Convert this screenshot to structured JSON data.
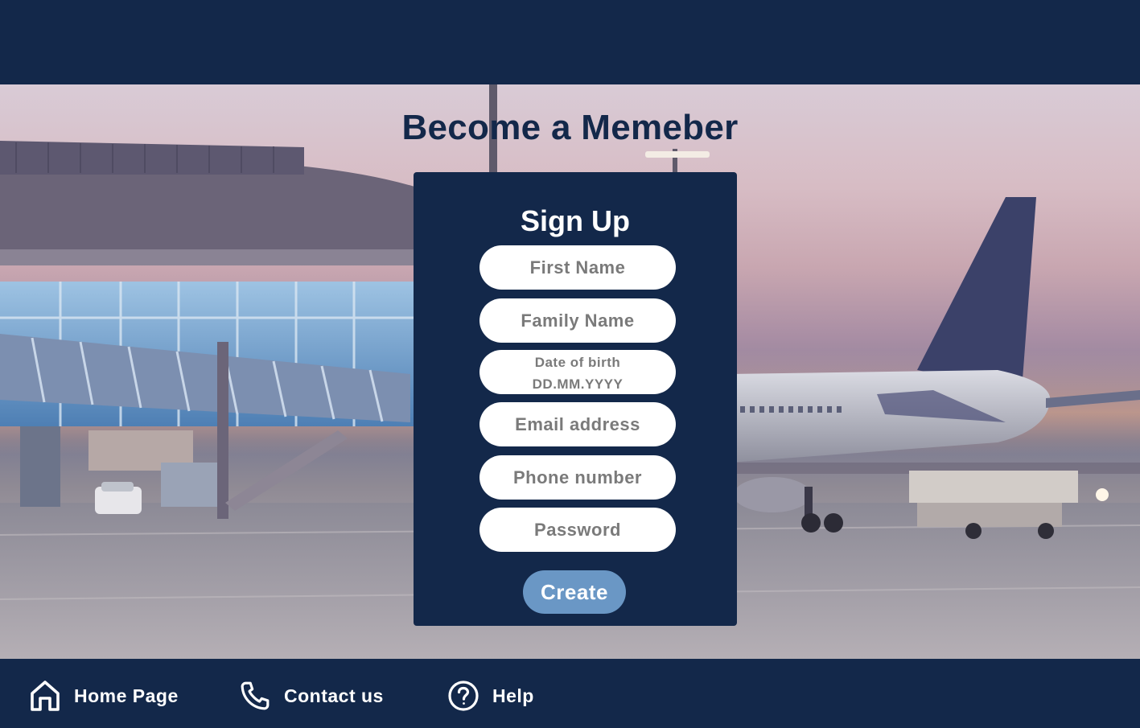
{
  "page": {
    "title": "Become a Memeber",
    "colors": {
      "navy": "#13284a",
      "button": "#6a97c5",
      "field": "#ffffff",
      "placeholder": "#7a7a7a"
    },
    "background_image": "airport-terminal-and-airplane-at-dusk"
  },
  "signup": {
    "heading": "Sign Up",
    "fields": {
      "first_name": {
        "placeholder": "First Name"
      },
      "family_name": {
        "placeholder": "Family Name"
      },
      "date_of_birth": {
        "placeholder_line1": "Date of birth",
        "placeholder_line2": "DD.MM.YYYY"
      },
      "email": {
        "placeholder": "Email address"
      },
      "phone": {
        "placeholder": "Phone number"
      },
      "password": {
        "placeholder": "Password"
      }
    },
    "submit_label": "Create"
  },
  "footer": {
    "items": [
      {
        "label": "Home Page",
        "icon": "home-icon"
      },
      {
        "label": "Contact us",
        "icon": "phone-icon"
      },
      {
        "label": "Help",
        "icon": "help-icon"
      }
    ]
  }
}
